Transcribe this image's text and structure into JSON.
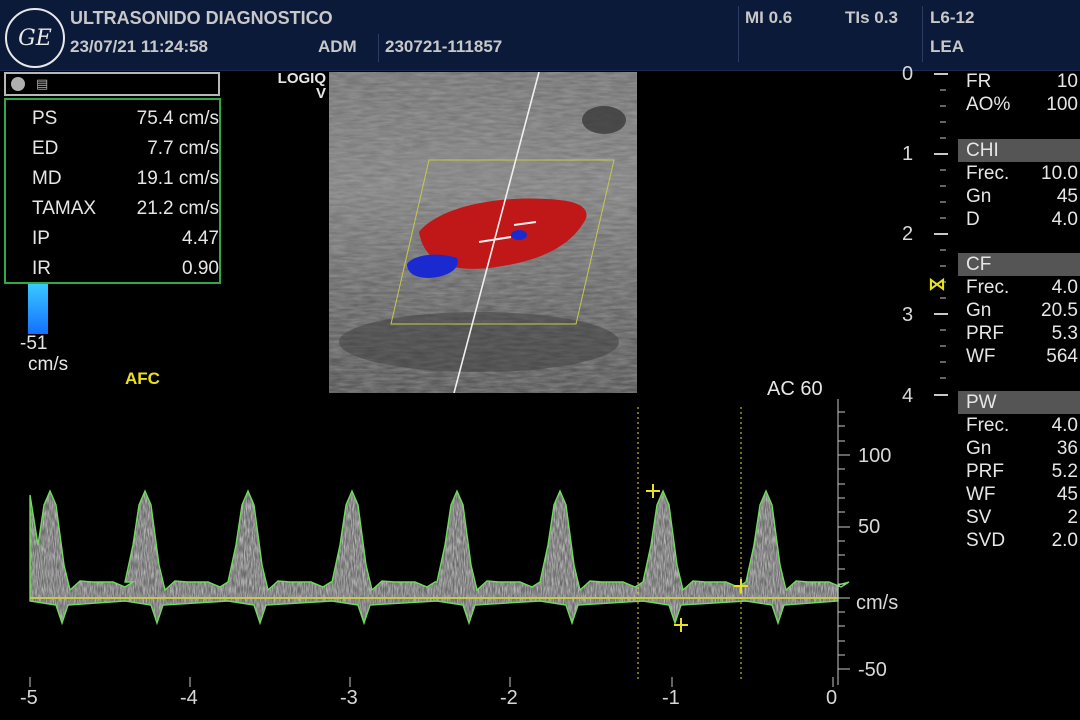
{
  "header": {
    "logo": "GE",
    "title": "ULTRASONIDO DIAGNOSTICO",
    "datetime": "23/07/21 11:24:58",
    "operator": "ADM",
    "exam_id": "230721-111857",
    "mi": "MI 0.6",
    "tis": "TIs 0.3",
    "probe": "L6-12",
    "preset": "LEA"
  },
  "measurements": [
    {
      "label": "PS",
      "value": "75.4 cm/s"
    },
    {
      "label": "ED",
      "value": "7.7 cm/s"
    },
    {
      "label": "MD",
      "value": "19.1 cm/s"
    },
    {
      "label": "TAMAX",
      "value": "21.2 cm/s"
    },
    {
      "label": "IP",
      "value": "4.47"
    },
    {
      "label": "IR",
      "value": "0.90"
    }
  ],
  "color_bar": {
    "value": "-51",
    "unit": "cm/s"
  },
  "afc_label": "AFC",
  "system": {
    "line1": "LOGIQ",
    "line2": "V"
  },
  "depth_scale": {
    "labels": [
      "0",
      "1",
      "2",
      "3",
      "4"
    ]
  },
  "spectral": {
    "ac_label": "AC 60",
    "velocity_labels": [
      "100",
      "50",
      "cm/s",
      "-50"
    ],
    "time_labels": [
      "-5",
      "-4",
      "-3",
      "-2",
      "-1",
      "0"
    ]
  },
  "params": {
    "top": [
      {
        "k": "FR",
        "v": "10"
      },
      {
        "k": "AO%",
        "v": "100"
      }
    ],
    "chi": {
      "title": "CHI",
      "rows": [
        {
          "k": "Frec.",
          "v": "10.0"
        },
        {
          "k": "Gn",
          "v": "45"
        },
        {
          "k": "D",
          "v": "4.0"
        }
      ]
    },
    "cf": {
      "title": "CF",
      "rows": [
        {
          "k": "Frec.",
          "v": "4.0"
        },
        {
          "k": "Gn",
          "v": "20.5"
        },
        {
          "k": "PRF",
          "v": "5.3"
        },
        {
          "k": "WF",
          "v": "564"
        }
      ]
    },
    "pw": {
      "title": "PW",
      "rows": [
        {
          "k": "Frec.",
          "v": "4.0"
        },
        {
          "k": "Gn",
          "v": "36"
        },
        {
          "k": "PRF",
          "v": "5.2"
        },
        {
          "k": "WF",
          "v": "45"
        },
        {
          "k": "SV",
          "v": "2"
        },
        {
          "k": "SVD",
          "v": "2.0"
        }
      ]
    }
  },
  "colors": {
    "accent_yellow": "#e8e020",
    "trace_green": "#6fdc5a",
    "header_bg": "#0c1a3a",
    "meas_border": "#2fa84a"
  }
}
